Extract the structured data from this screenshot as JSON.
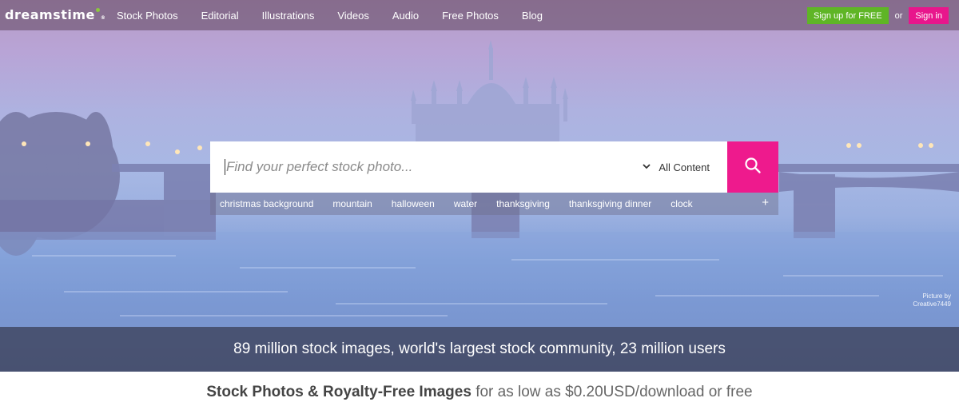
{
  "brand": {
    "logo_text": "dreamstime"
  },
  "nav": {
    "items": [
      "Stock Photos",
      "Editorial",
      "Illustrations",
      "Videos",
      "Audio",
      "Free Photos",
      "Blog"
    ]
  },
  "auth": {
    "signup_label": "Sign up for FREE",
    "or_text": "or",
    "signin_label": "Sign in"
  },
  "search": {
    "placeholder": "Find your perfect stock photo...",
    "content_type": "All Content",
    "suggestions": [
      "christmas background",
      "mountain",
      "halloween",
      "water",
      "thanksgiving",
      "thanksgiving dinner",
      "clock"
    ],
    "more_symbol": "+"
  },
  "hero": {
    "credit_line1": "Picture by",
    "credit_line2": "Creative7449"
  },
  "stats_text": "89 million stock images, world's largest stock community, 23 million users",
  "tagline": {
    "bold": "Stock Photos & Royalty-Free Images",
    "rest": " for as low as $0.20USD/download or free"
  },
  "colors": {
    "signup": "#5fb526",
    "signin": "#e8168c",
    "search_button": "#ee1a8d"
  }
}
